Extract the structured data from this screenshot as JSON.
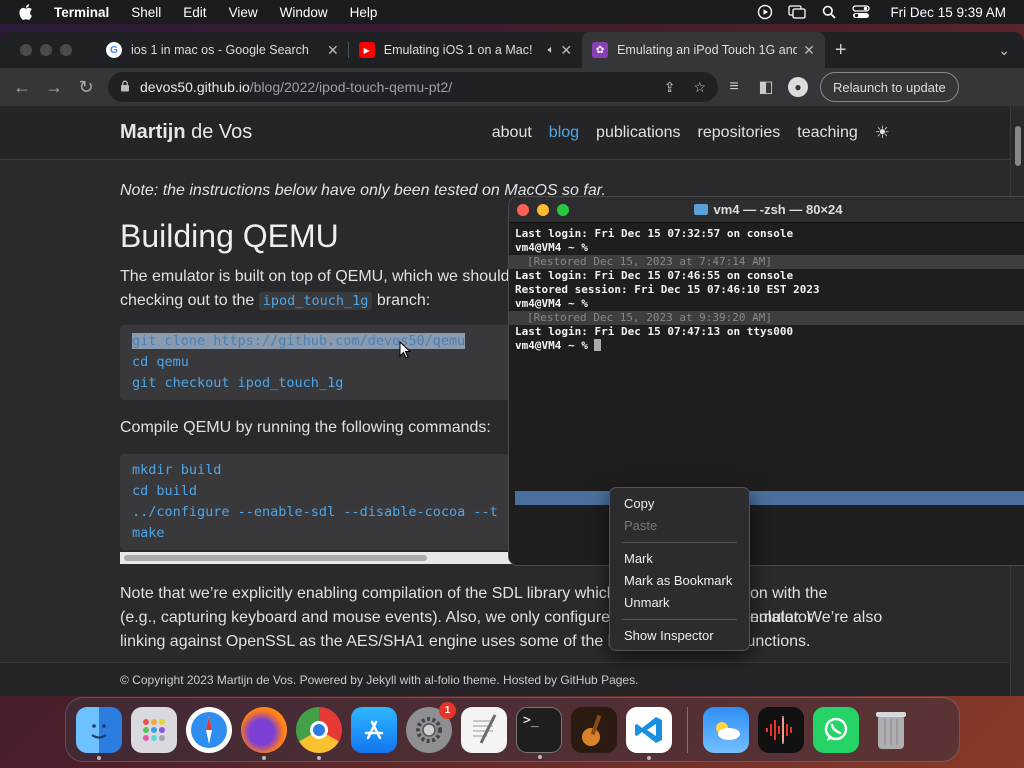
{
  "menubar": {
    "app_name": "Terminal",
    "items": [
      "Shell",
      "Edit",
      "View",
      "Window",
      "Help"
    ],
    "clock": "Fri Dec 15  9:39 AM"
  },
  "browser": {
    "tabs": [
      {
        "title": "ios 1 in mac os - Google Search",
        "favicon": "google-icon",
        "active": false
      },
      {
        "title": "Emulating iOS 1 on a Mac!",
        "favicon": "youtube-icon",
        "active": false
      },
      {
        "title": "Emulating an iPod Touch 1G and",
        "favicon": "site-icon",
        "active": true
      }
    ],
    "url_host": "devos50.github.io",
    "url_path": "/blog/2022/ipod-touch-qemu-pt2/",
    "relaunch_label": "Relaunch to update"
  },
  "site": {
    "brand_first": "Martijn",
    "brand_last": " de Vos",
    "nav": [
      "about",
      "blog",
      "publications",
      "repositories",
      "teaching"
    ],
    "active_nav": "blog",
    "note": "Note: the instructions below have only been tested on MacOS so far.",
    "heading": "Building QEMU",
    "para1_a": "The emulator is built on top of QEMU, which we should b",
    "para1_b": "checking out to the",
    "para1_code": "ipod_touch_1g",
    "para1_c": " branch:",
    "code1": [
      "git clone https://github.com/devos50/qemu",
      "cd qemu",
      "git checkout ipod_touch_1g"
    ],
    "para2": "Compile QEMU by running the following commands:",
    "code2": [
      "mkdir build",
      "cd build",
      "../configure --enable-sdl --disable-cocoa --t",
      "make"
    ],
    "para3_l1": "Note that we’re explicitly enabling compilation of the SDL library which",
    "para3_l1b": "on with the emulator",
    "para3_l2": "(e.g., capturing keyboard and mouse events). Also, we only configure a",
    "para3_l2b": "nulator. We’re also",
    "para3_l3": "linking against OpenSSL as the AES/SHA1 engine uses some of the lib",
    "para3_l3b": "functions.",
    "footer": "© Copyright 2023 Martijn de Vos. Powered by Jekyll with al-folio theme. Hosted by GitHub Pages."
  },
  "terminal": {
    "title": "vm4 — -zsh — 80×24",
    "lines": [
      {
        "text": "Last login: Fri Dec 15 07:32:57 on console",
        "mark": false
      },
      {
        "text": "vm4@VM4 ~ %",
        "mark": false
      },
      {
        "text": "[Restored Dec 15, 2023 at 7:47:14 AM]",
        "mark": true
      },
      {
        "text": "Last login: Fri Dec 15 07:46:55 on console",
        "mark": false
      },
      {
        "text": "Restored session: Fri Dec 15 07:46:10 EST 2023",
        "mark": false
      },
      {
        "text": "vm4@VM4 ~ %",
        "mark": false
      },
      {
        "text": "[Restored Dec 15, 2023 at 9:39:20 AM]",
        "mark": true
      },
      {
        "text": "Last login: Fri Dec 15 07:47:13 on ttys000",
        "mark": false
      },
      {
        "text": "vm4@VM4 ~ % ",
        "mark": false
      }
    ]
  },
  "context_menu": {
    "copy": "Copy",
    "paste": "Paste",
    "mark": "Mark",
    "mark_bookmark": "Mark as Bookmark",
    "unmark": "Unmark",
    "show_inspector": "Show Inspector"
  },
  "dock": {
    "apps": [
      "finder-icon",
      "launchpad-icon",
      "safari-icon",
      "firefox-icon",
      "chrome-icon",
      "app-store-icon",
      "system-settings-icon",
      "textedit-icon",
      "terminal-icon",
      "garageband-icon",
      "vscode-icon",
      "weather-icon",
      "voice-memos-icon",
      "whatsapp-icon",
      "trash-icon"
    ],
    "settings_badge": "1"
  }
}
